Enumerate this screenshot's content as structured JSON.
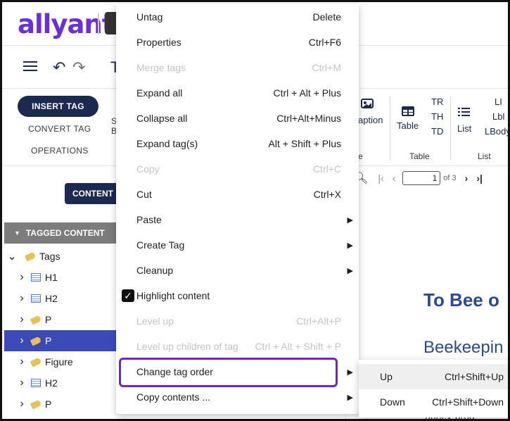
{
  "brand": {
    "logo_text": "allyant"
  },
  "toolbar": {
    "title_fragment": "T"
  },
  "ribbon": {
    "insert_tag": "INSERT TAG",
    "convert_tag": "CONVERT TAG",
    "operations": "OPERATIONS",
    "s_fragment": "S",
    "b_fragment": "B",
    "caption": "aption",
    "table": "Table",
    "tr": "TR",
    "th": "TH",
    "td": "TD",
    "list": "List",
    "li": "LI",
    "lbl": "Lbl",
    "lbody": "LBody",
    "group_e": "e",
    "group_table": "Table",
    "group_list": "List"
  },
  "left_panel": {
    "content_button": "CONTENT",
    "tagged_content_header": "TAGGED CONTENT",
    "tree": [
      {
        "label": "Tags",
        "icon": "tag-icon",
        "expanded": true,
        "selected": false
      },
      {
        "label": "H1",
        "icon": "heading-icon",
        "expanded": false,
        "selected": false
      },
      {
        "label": "H2",
        "icon": "heading-icon",
        "expanded": false,
        "selected": false
      },
      {
        "label": "P",
        "icon": "tag-icon",
        "expanded": false,
        "selected": false
      },
      {
        "label": "P",
        "icon": "tag-icon",
        "expanded": false,
        "selected": true
      },
      {
        "label": "Figure",
        "icon": "tag-icon",
        "expanded": false,
        "selected": false
      },
      {
        "label": "H2",
        "icon": "heading-icon",
        "expanded": false,
        "selected": false
      },
      {
        "label": "P",
        "icon": "tag-icon",
        "expanded": false,
        "selected": false
      }
    ]
  },
  "pager": {
    "page": "1",
    "of": "of 3"
  },
  "document": {
    "heading1": "To Bee o",
    "heading2": "Beekeepin",
    "fragment": "honey-prod"
  },
  "context_menu": {
    "items": [
      {
        "label": "Untag",
        "shortcut": "Delete",
        "disabled": false,
        "submenu": false
      },
      {
        "label": "Properties",
        "shortcut": "Ctrl+F6",
        "disabled": false,
        "submenu": false
      },
      {
        "label": "Merge tags",
        "shortcut": "Ctrl+M",
        "disabled": true,
        "submenu": false
      },
      {
        "label": "Expand all",
        "shortcut": "Ctrl + Alt + Plus",
        "disabled": false,
        "submenu": false
      },
      {
        "label": "Collapse all",
        "shortcut": "Ctrl+Alt+Minus",
        "disabled": false,
        "submenu": false
      },
      {
        "label": "Expand tag(s)",
        "shortcut": "Alt + Shift + Plus",
        "disabled": false,
        "submenu": false
      },
      {
        "label": "Copy",
        "shortcut": "Ctrl+C",
        "disabled": true,
        "submenu": false
      },
      {
        "label": "Cut",
        "shortcut": "Ctrl+X",
        "disabled": false,
        "submenu": false
      },
      {
        "label": "Paste",
        "shortcut": "",
        "disabled": false,
        "submenu": true
      },
      {
        "label": "Create Tag",
        "shortcut": "",
        "disabled": false,
        "submenu": true
      },
      {
        "label": "Cleanup",
        "shortcut": "",
        "disabled": false,
        "submenu": true
      },
      {
        "label": "Highlight content",
        "shortcut": "",
        "disabled": false,
        "submenu": false,
        "checked": true
      },
      {
        "label": "Level up",
        "shortcut": "Ctrl+Alt+P",
        "disabled": true,
        "submenu": false
      },
      {
        "label": "Level up children of tag",
        "shortcut": "Ctrl + Alt + Shift + P",
        "disabled": true,
        "submenu": false
      },
      {
        "label": "Change tag order",
        "shortcut": "",
        "disabled": false,
        "submenu": true,
        "highlighted": true
      },
      {
        "label": "Copy contents ...",
        "shortcut": "",
        "disabled": false,
        "submenu": true
      }
    ]
  },
  "submenu": {
    "items": [
      {
        "label": "Up",
        "shortcut": "Ctrl+Shift+Up",
        "hover": true
      },
      {
        "label": "Down",
        "shortcut": "Ctrl+Shift+Down",
        "hover": false
      }
    ]
  },
  "colors": {
    "brand_purple": "#6b2fd6",
    "navy": "#1b2a4e",
    "selected_row": "#3c4ab8",
    "highlight_outline": "#7a1fd0",
    "doc_heading": "#2c4a8c"
  }
}
